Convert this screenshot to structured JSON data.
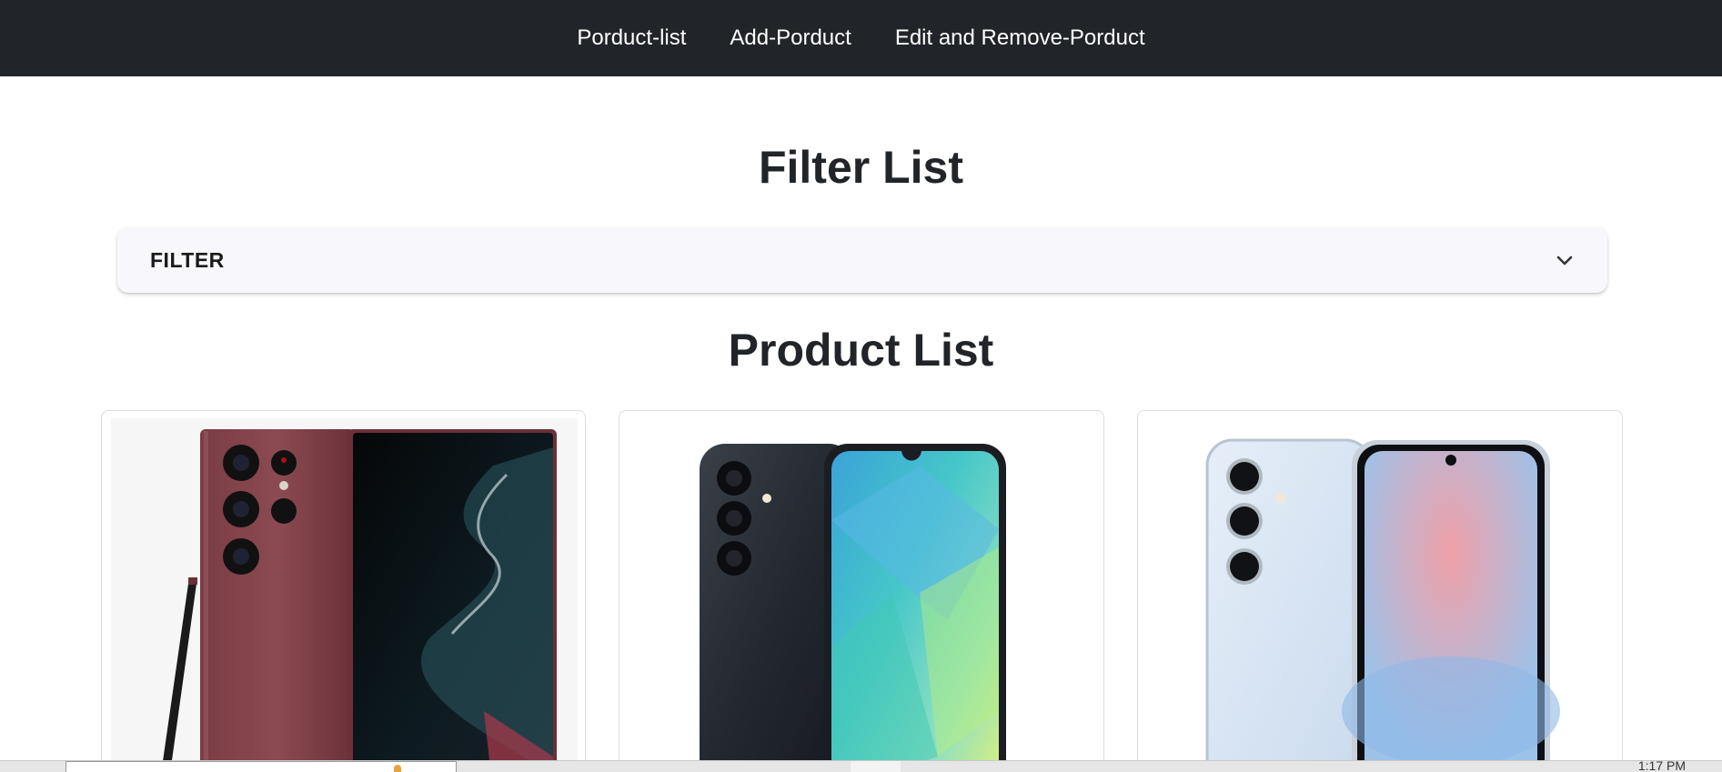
{
  "nav": {
    "links": [
      {
        "label": "Porduct-list"
      },
      {
        "label": "Add-Porduct"
      },
      {
        "label": "Edit and Remove-Porduct"
      }
    ]
  },
  "filter_section": {
    "title": "Filter List",
    "accordion_label": "FILTER",
    "accordion_icon": "chevron-down-icon"
  },
  "product_section": {
    "title": "Product List",
    "cards": [
      {
        "image": "phone-burgundy-stylus-image"
      },
      {
        "image": "phone-navy-teal-image"
      },
      {
        "image": "phone-lightblue-image"
      }
    ]
  },
  "taskbar": {
    "clock_fragment": "1:17 PM"
  },
  "colors": {
    "navbar_bg": "#212529",
    "nav_text": "#ffffff",
    "accordion_bg": "#f8f8fc",
    "heading_text": "#212529"
  }
}
